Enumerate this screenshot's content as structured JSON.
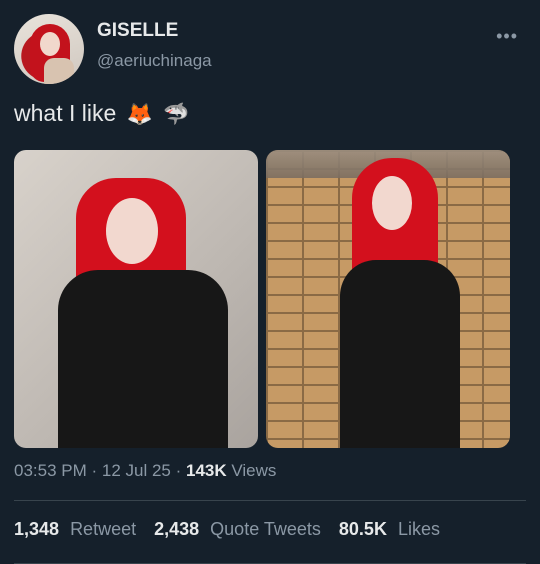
{
  "tweet": {
    "author": {
      "name": "GISELLE",
      "handle": "@aeriuchinaga"
    },
    "text": "what I like",
    "emojis": [
      "🦊",
      "🦈"
    ],
    "timestamp": "03:53 PM · 12 Jul 25",
    "views": {
      "count": "143K",
      "label": "Views"
    },
    "stats": [
      {
        "count": "1,348",
        "label": "Retweet"
      },
      {
        "count": "2,438",
        "label": "Quote Tweets"
      },
      {
        "count": "80.5K",
        "label": "Likes"
      }
    ],
    "more_icon": "ellipsis-icon"
  }
}
